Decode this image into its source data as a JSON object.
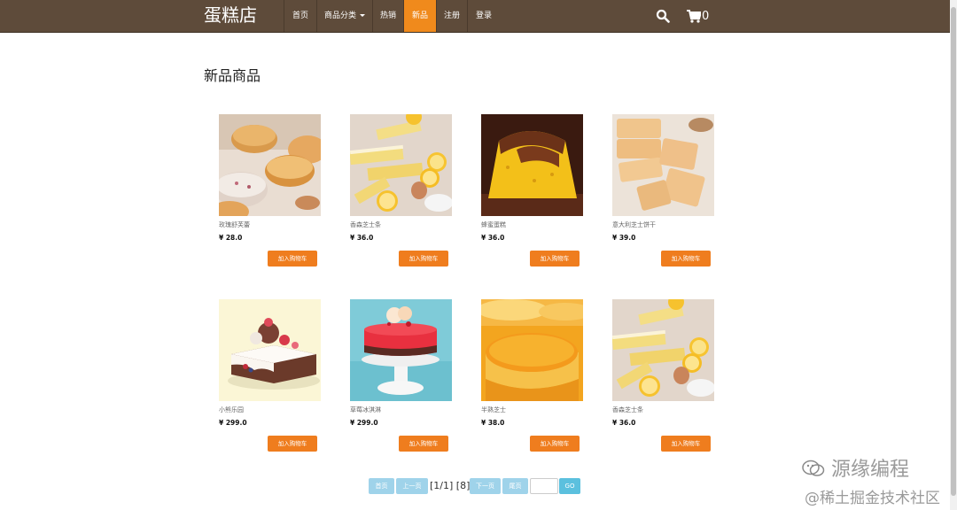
{
  "nav": {
    "brand": "蛋糕店",
    "items": [
      {
        "label": "首页"
      },
      {
        "label": "商品分类"
      },
      {
        "label": "热销"
      },
      {
        "label": "新品"
      },
      {
        "label": "注册"
      },
      {
        "label": "登录"
      }
    ],
    "cart_count": "0"
  },
  "section_title": "新品商品",
  "add_label": "加入购物车",
  "products": [
    {
      "name": "玫瑰舒芙蕾",
      "price": "¥ 28.0"
    },
    {
      "name": "香森芝士条",
      "price": "¥ 36.0"
    },
    {
      "name": "蜂蜜蛋糕",
      "price": "¥ 36.0"
    },
    {
      "name": "意大利芝士饼干",
      "price": "¥ 39.0"
    },
    {
      "name": "小熊乐园",
      "price": "¥ 299.0"
    },
    {
      "name": "草莓冰淇淋",
      "price": "¥ 299.0"
    },
    {
      "name": "半熟芝士",
      "price": "¥ 38.0"
    },
    {
      "name": "香森芝士条",
      "price": "¥ 36.0"
    }
  ],
  "pagination": {
    "first": "首页",
    "prev": "上一页",
    "info": "[1/1] [8]",
    "next": "下一页",
    "last": "尾页",
    "go": "GO"
  },
  "watermark": {
    "line1": "源缘编程",
    "line2": "@稀土掘金技术社区"
  },
  "colors": {
    "navbar": "#5e4b3a",
    "accent": "#f08a1c",
    "add_button": "#ef7d1e",
    "pager_button": "#9fd3ea"
  }
}
